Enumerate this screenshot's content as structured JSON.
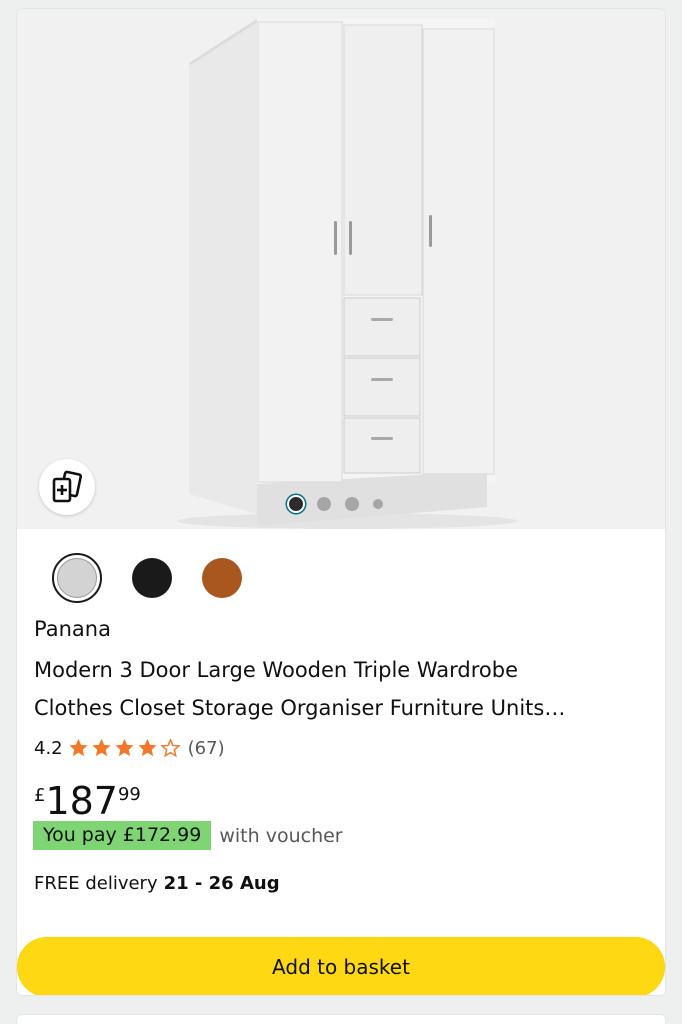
{
  "product": {
    "image_alt": "white three door wardrobe",
    "gallery": {
      "image_count": 4,
      "active_index": 0
    },
    "swatches": [
      {
        "name": "white",
        "color": "#d3d3d3",
        "selected": true
      },
      {
        "name": "black",
        "color": "#1a1a1a",
        "selected": false
      },
      {
        "name": "brown",
        "color": "#a9561f",
        "selected": false
      }
    ],
    "brand": "Panana",
    "title_line1": "Modern 3 Door Large Wooden Triple Wardrobe",
    "title_line2": "Clothes Closet Storage Organiser Furniture Units…",
    "rating": {
      "value": "4.2",
      "stars": 4.2,
      "count": "(67)"
    },
    "price": {
      "currency": "£",
      "whole": "187",
      "fraction": "99"
    },
    "voucher": {
      "badge": "You pay £172.99",
      "text": "with voucher"
    },
    "delivery": {
      "label": "FREE delivery",
      "dates": "21 - 26 Aug"
    },
    "add_to_basket": "Add to basket"
  },
  "colors": {
    "star": "#f3782a",
    "button": "#ffd814",
    "voucher_badge": "#7fd473",
    "focus_ring": "#007185"
  },
  "icons": {
    "compare": "compare-plus-icon"
  }
}
